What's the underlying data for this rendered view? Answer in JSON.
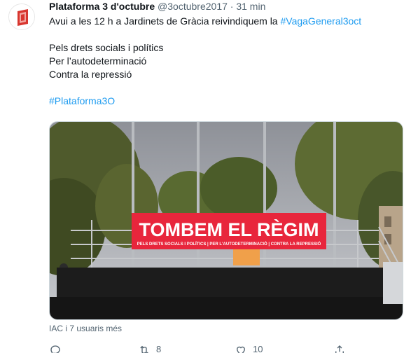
{
  "tweet": {
    "author_name": "Plataforma 3 d'octubre",
    "author_handle": "@3octubre2017",
    "separator": "·",
    "time_ago": "31 min",
    "text_line1_prefix": "Avui a les 12 h a Jardinets de Gràcia reivindiquem la ",
    "text_line1_hashtag": "#VagaGeneral3oct",
    "text_line2": "Pels drets socials i polítics",
    "text_line3": "Per l’autodeterminació",
    "text_line4": "Contra la repressió",
    "text_hashtag2": "#Plataforma3O",
    "media": {
      "banner_main": "TOMBEM EL RÈGIM",
      "banner_sub": "PELS DRETS SOCIALS I POLÍTICS | PER L'AUTODETERMINACIÓ | CONTRA LA REPRESSIÓ"
    },
    "tagged": "IAC i 7 usuaris més",
    "actions": {
      "reply_icon": "reply-icon",
      "retweet_icon": "retweet-icon",
      "retweet_count": "8",
      "like_icon": "heart-icon",
      "like_count": "10",
      "share_icon": "share-icon"
    }
  },
  "colors": {
    "text": "#0f1419",
    "secondary": "#536471",
    "link": "#1d9bf0",
    "avatar_red": "#d8362f",
    "banner_red": "#e8263c"
  }
}
